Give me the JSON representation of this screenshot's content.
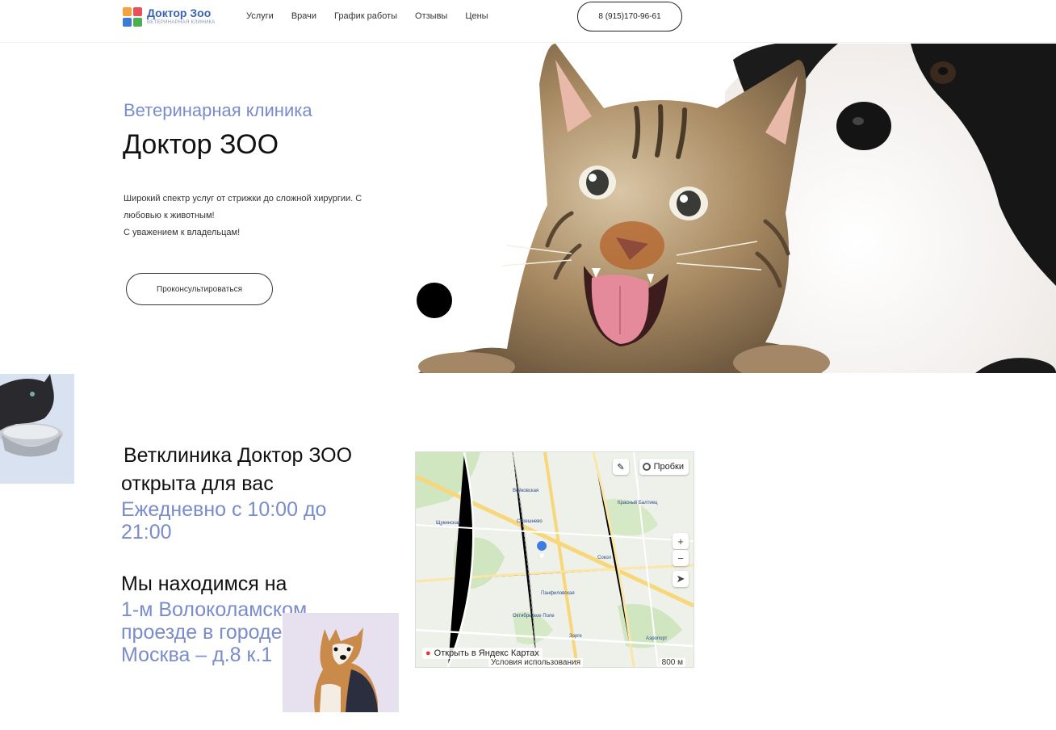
{
  "header": {
    "logo_title": "Доктор Зоо",
    "logo_subtitle": "Ветеринарная клиника",
    "nav": [
      "Услуги",
      "Врачи",
      "График работы",
      "Отзывы",
      "Цены"
    ],
    "phone": "8 (915)170-96-61"
  },
  "hero": {
    "subtitle": "Ветеринарная клиника",
    "title": "Доктор ЗОО",
    "description_lines": [
      "Широкий спектр услуг от стрижки до сложной хирургии. С",
      "любовью к животным!",
      "С уважением к владельцам!"
    ],
    "consult_button": "Проконсультироваться"
  },
  "info": {
    "line1": "Ветклиника Доктор ЗОО",
    "line2": "открыта для вас",
    "hours": "Ежедневно с 10:00 до 21:00",
    "location_label": "Мы находимся на",
    "address_lines": [
      "1-м Волоколамском",
      "проезде в городе",
      "Москва – д.8 к.1"
    ]
  },
  "map": {
    "traffic": "Пробки",
    "open_link": "Открыть в Яндекс Картах",
    "terms": "Условия использования",
    "scale": "800 м",
    "stations": [
      "Сокол",
      "Панфиловская",
      "Октябрьское Поле",
      "Щукинская",
      "Войковская",
      "Стрешнево",
      "Красный Балтиец",
      "Зорге",
      "Аэропорт"
    ]
  },
  "colors": {
    "accent": "#7a8cc9",
    "logo_blue": "#3a63b8"
  }
}
